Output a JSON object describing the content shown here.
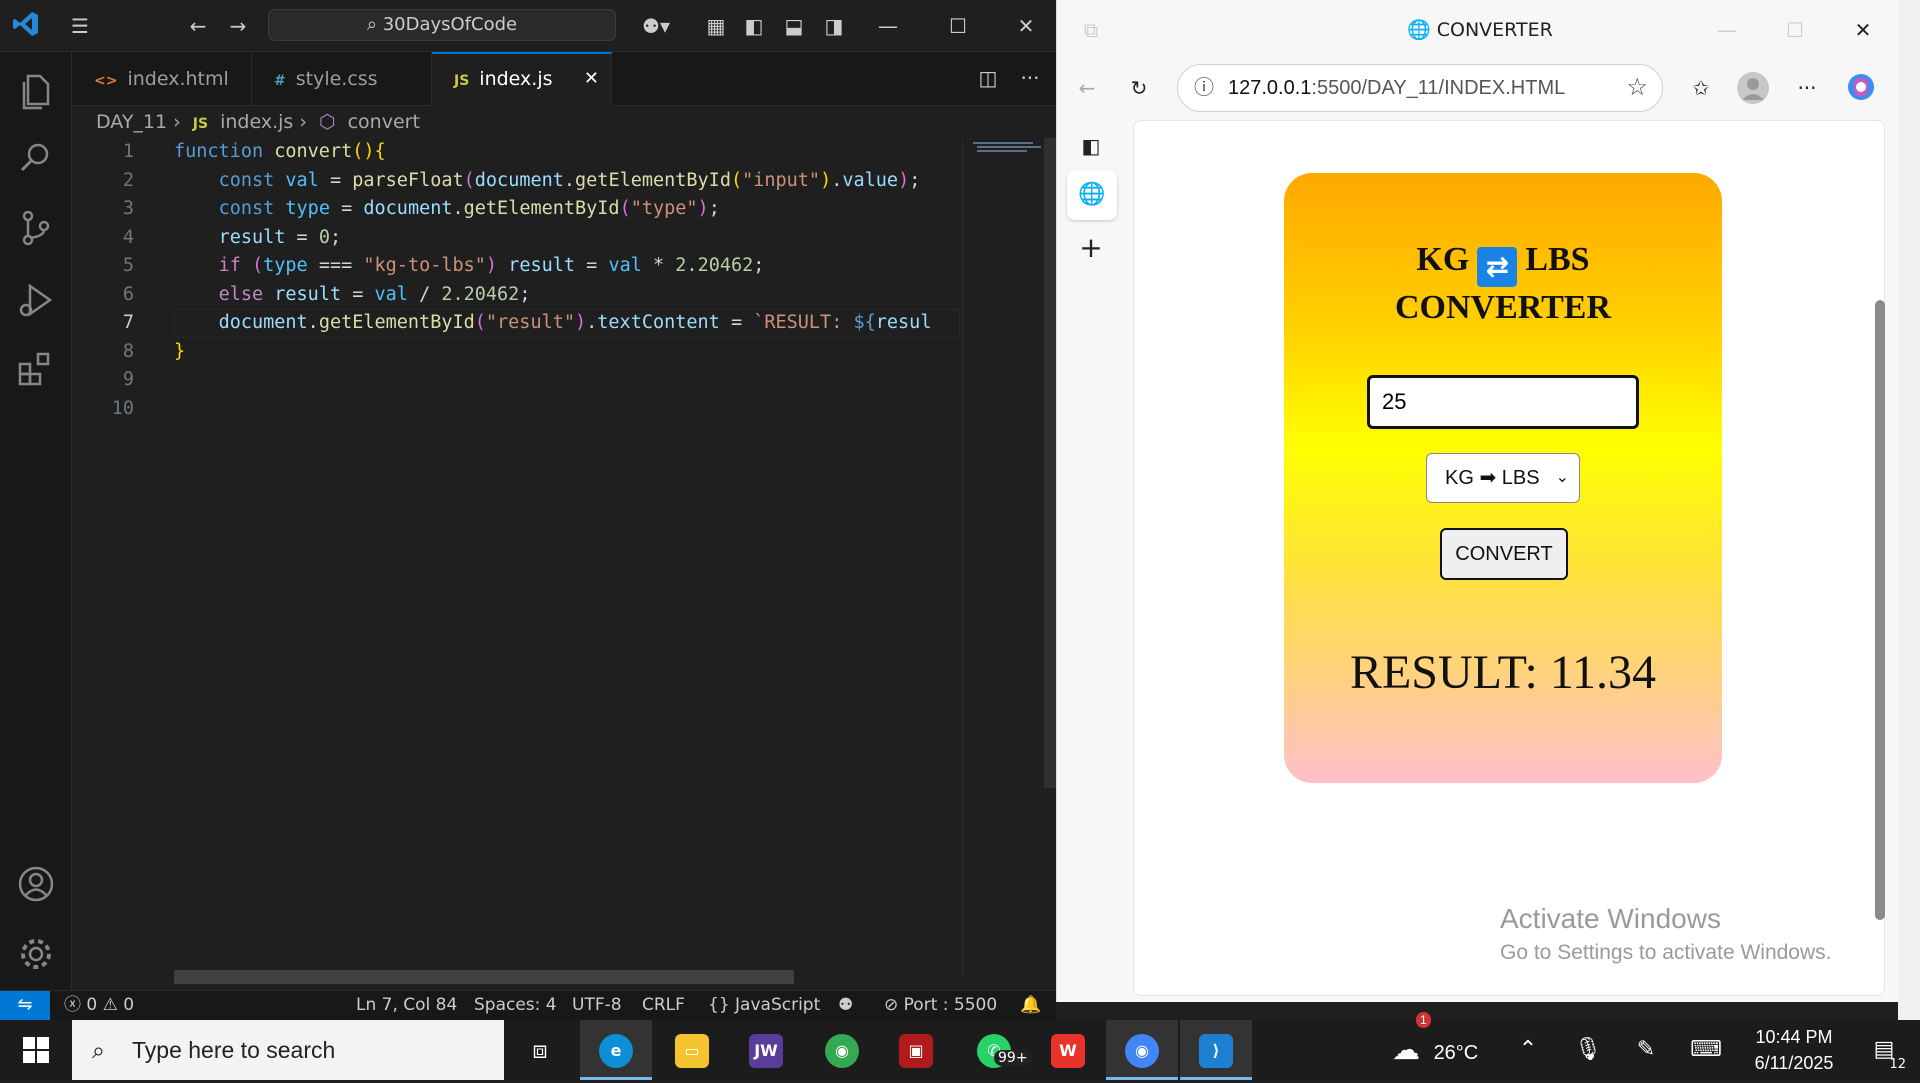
{
  "vscode": {
    "search_text": "30DaysOfCode",
    "tabs": [
      {
        "label": "index.html",
        "icon": "<>"
      },
      {
        "label": "style.css",
        "icon": "#"
      },
      {
        "label": "index.js",
        "icon": "JS"
      }
    ],
    "breadcrumb": {
      "folder": "DAY_11",
      "file": "index.js",
      "symbol": "convert"
    },
    "code_lines": [
      {
        "num": "1",
        "text": "function convert(){"
      },
      {
        "num": "2",
        "text": "    const val = parseFloat(document.getElementById(\"input\").value);"
      },
      {
        "num": "3",
        "text": "    const type = document.getElementById(\"type\");"
      },
      {
        "num": "4",
        "text": "    result = 0;"
      },
      {
        "num": "5",
        "text": "    if (type === \"kg-to-lbs\") result = val * 2.20462;"
      },
      {
        "num": "6",
        "text": "    else result = val / 2.20462;"
      },
      {
        "num": "7",
        "text": "    document.getElementById(\"result\").textContent = `RESULT: ${resul"
      },
      {
        "num": "8",
        "text": "}"
      },
      {
        "num": "9",
        "text": ""
      },
      {
        "num": "10",
        "text": ""
      }
    ],
    "status": {
      "errors": "0",
      "warnings": "0",
      "position": "Ln 7, Col 84",
      "spaces": "Spaces: 4",
      "encoding": "UTF-8",
      "eol": "CRLF",
      "language": "JavaScript",
      "port": "Port : 5500"
    }
  },
  "browser": {
    "title": "CONVERTER",
    "url_host": "127.0.0.1",
    "url_path": ":5500/DAY_11/INDEX.HTML",
    "page": {
      "title_line1_a": "KG",
      "title_line1_b": "LBS",
      "title_line2": "CONVERTER",
      "input_value": "25",
      "select_value": "KG ➡ LBS",
      "button_label": "CONVERT",
      "result": "RESULT: 11.34"
    },
    "watermark": {
      "line1": "Activate Windows",
      "line2": "Go to Settings to activate Windows."
    }
  },
  "taskbar": {
    "search_placeholder": "Type here to search",
    "weather": "26°C",
    "weather_badge": "1",
    "whatsapp_badge": "99+",
    "time": "10:44 PM",
    "date": "6/11/2025",
    "notifications": "12"
  },
  "colors": {
    "vscode_bg": "#1f1f1f",
    "accent": "#0078d4",
    "card_top": "#ffa800",
    "card_mid": "#ffff00",
    "card_bottom": "#ffc0cb"
  }
}
